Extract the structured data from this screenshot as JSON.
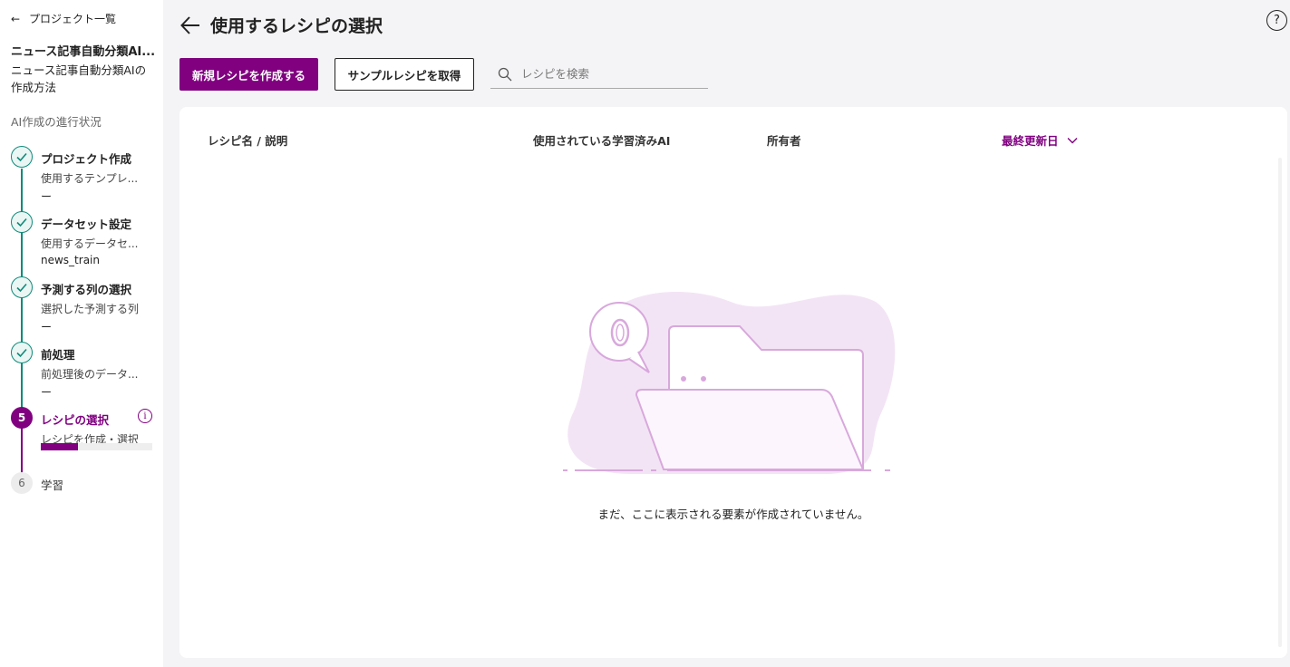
{
  "sidebar": {
    "back_label": "プロジェクト一覧",
    "project_name": "ニュース記事自動分類AI...",
    "project_desc": "ニュース記事自動分類AIの作成方法",
    "progress_heading": "AI作成の進行状況",
    "steps": [
      {
        "title": "プロジェクト作成",
        "sub": "使用するテンプレ...",
        "value": "ー",
        "status": "done"
      },
      {
        "title": "データセット設定",
        "sub": "使用するデータセ...",
        "value": "news_train",
        "status": "done"
      },
      {
        "title": "予測する列の選択",
        "sub": "選択した予測する列",
        "value": "ー",
        "status": "done"
      },
      {
        "title": "前処理",
        "sub": "前処理後のデータ...",
        "value": "ー",
        "status": "done"
      },
      {
        "number": "5",
        "title": "レシピの選択",
        "sub": "レシピを作成・選択",
        "progress": 0.33,
        "status": "active"
      },
      {
        "number": "6",
        "title": "学習",
        "status": "pending"
      }
    ]
  },
  "header": {
    "title": "使用するレシピの選択"
  },
  "toolbar": {
    "create_label": "新規レシピを作成する",
    "sample_label": "サンプルレシピを取得",
    "search_placeholder": "レシピを検索"
  },
  "table": {
    "columns": [
      "レシピ名 / 説明",
      "使用されている学習済みAI",
      "所有者",
      "最終更新日"
    ],
    "sort_column": "最終更新日",
    "sort_direction": "desc",
    "rows": []
  },
  "empty_message": "まだ、ここに表示される要素が作成されていません。",
  "colors": {
    "accent": "#800080",
    "done": "#0e8a7a",
    "illustration": "#d8a8dc"
  }
}
